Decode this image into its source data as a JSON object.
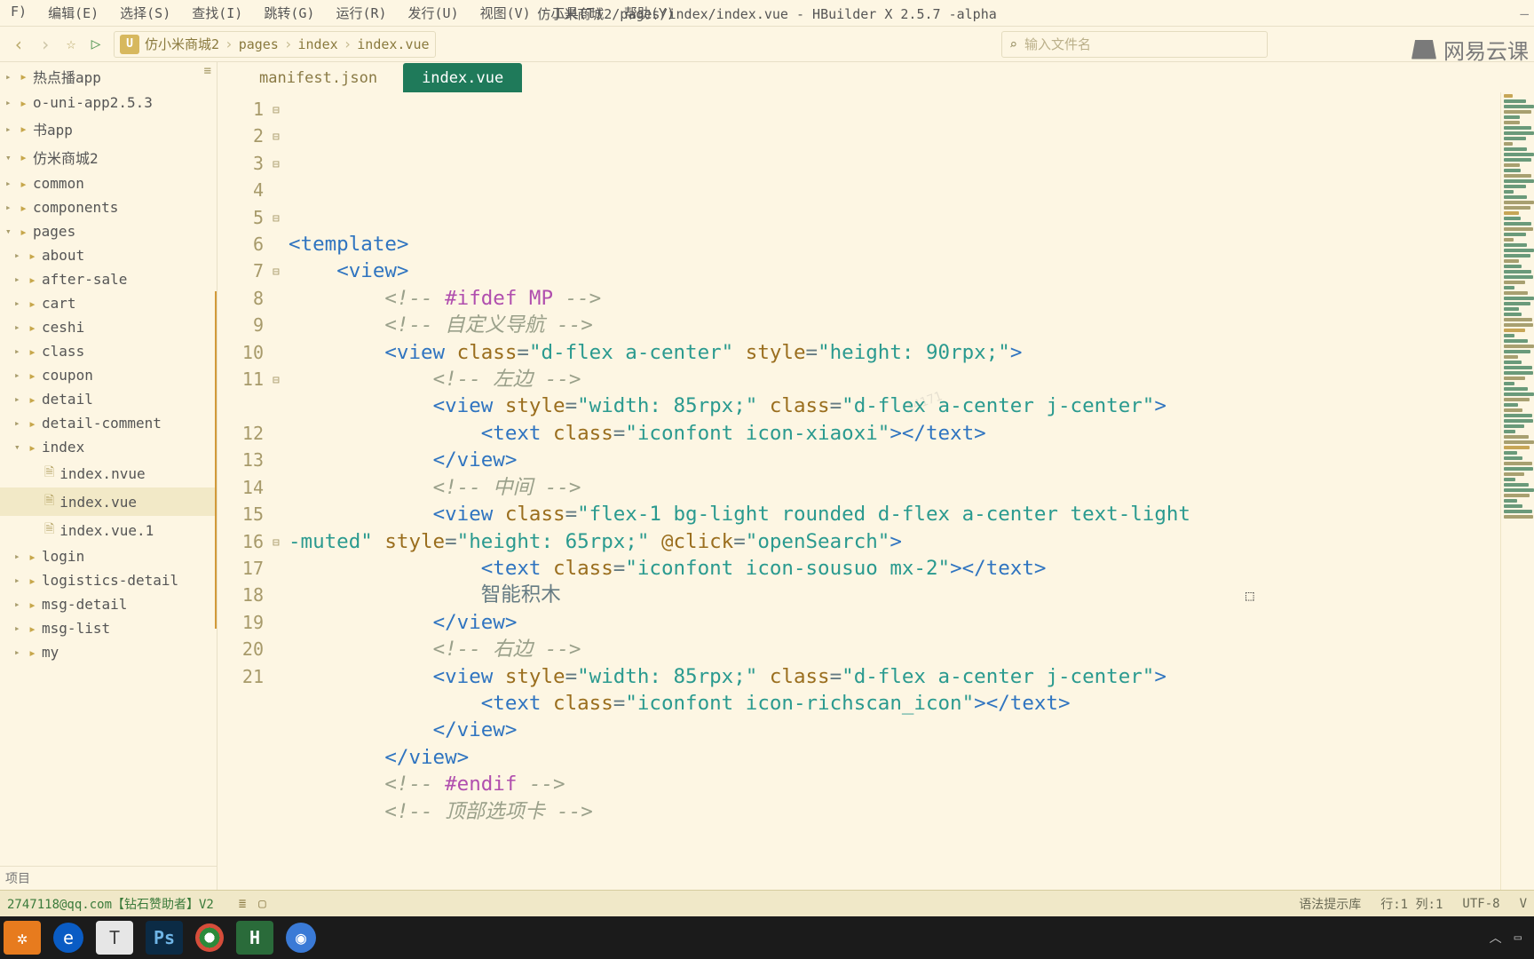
{
  "menu": [
    "F)",
    "编辑(E)",
    "选择(S)",
    "查找(I)",
    "跳转(G)",
    "运行(R)",
    "发行(U)",
    "视图(V)",
    "工具(T)",
    "帮助(Y)"
  ],
  "app_title": "仿小米商城2/pages/index/index.vue - HBuilder X 2.5.7 -alpha",
  "breadcrumb": [
    "仿小米商城2",
    "pages",
    "index",
    "index.vue"
  ],
  "search_placeholder": "输入文件名",
  "brand_text": "网易云课",
  "sidebar": {
    "roots": [
      {
        "label": "热点播app",
        "type": "folder"
      },
      {
        "label": "o-uni-app2.5.3",
        "type": "folder"
      },
      {
        "label": "书app",
        "type": "folder"
      },
      {
        "label": "仿米商城2",
        "type": "folder",
        "expanded": true
      }
    ],
    "children": [
      {
        "label": "common"
      },
      {
        "label": "components"
      },
      {
        "label": "pages",
        "expanded": true,
        "subs": [
          {
            "label": "about"
          },
          {
            "label": "after-sale"
          },
          {
            "label": "cart"
          },
          {
            "label": "ceshi"
          },
          {
            "label": "class"
          },
          {
            "label": "coupon"
          },
          {
            "label": "detail"
          },
          {
            "label": "detail-comment"
          },
          {
            "label": "index",
            "expanded": true,
            "files": [
              {
                "label": "index.nvue"
              },
              {
                "label": "index.vue",
                "active": true
              },
              {
                "label": "index.vue.1"
              }
            ]
          },
          {
            "label": "login"
          },
          {
            "label": "logistics-detail"
          },
          {
            "label": "msg-detail"
          },
          {
            "label": "msg-list"
          },
          {
            "label": "my"
          }
        ]
      }
    ],
    "bottom": "项目"
  },
  "tabs": [
    {
      "label": "manifest.json",
      "active": false
    },
    {
      "label": "index.vue",
      "active": true
    }
  ],
  "code_lines": [
    {
      "n": 1,
      "fold": "⊟",
      "html": "<span class='c-tag'>&lt;template&gt;</span>",
      "hl": true
    },
    {
      "n": 2,
      "fold": "⊟",
      "html": "    <span class='c-tag'>&lt;view&gt;</span>"
    },
    {
      "n": 3,
      "fold": "⊟",
      "html": "        <span class='c-cmt'>&lt;!--</span> <span class='c-kw'>#ifdef MP</span> <span class='c-cmt'>--&gt;</span>"
    },
    {
      "n": 4,
      "fold": "",
      "html": "        <span class='c-cmt'>&lt;!-- 自定义导航 --&gt;</span>"
    },
    {
      "n": 5,
      "fold": "⊟",
      "html": "        <span class='c-tag'>&lt;view</span> <span class='c-attr'>class</span>=<span class='c-str'>\"d-flex a-center\"</span> <span class='c-attr'>style</span>=<span class='c-str'>\"height: 90rpx;\"</span><span class='c-tag'>&gt;</span>"
    },
    {
      "n": 6,
      "fold": "",
      "html": "            <span class='c-cmt'>&lt;!-- 左边 --&gt;</span>"
    },
    {
      "n": 7,
      "fold": "⊟",
      "html": "            <span class='c-tag'>&lt;view</span> <span class='c-attr'>style</span>=<span class='c-str'>\"width: 85rpx;\"</span> <span class='c-attr'>class</span>=<span class='c-str'>\"d-flex a-center j-center\"</span><span class='c-tag'>&gt;</span>"
    },
    {
      "n": 8,
      "fold": "",
      "html": "                <span class='c-tag'>&lt;text</span> <span class='c-attr'>class</span>=<span class='c-str'>\"iconfont icon-xiaoxi\"</span><span class='c-tag'>&gt;&lt;/text&gt;</span>"
    },
    {
      "n": 9,
      "fold": "",
      "html": "            <span class='c-tag'>&lt;/view&gt;</span>"
    },
    {
      "n": 10,
      "fold": "",
      "html": "            <span class='c-cmt'>&lt;!-- 中间 --&gt;</span>"
    },
    {
      "n": 11,
      "fold": "⊟",
      "html": "            <span class='c-tag'>&lt;view</span> <span class='c-attr'>class</span>=<span class='c-str'>\"flex-1 bg-light rounded d-flex a-center text-light</span>"
    },
    {
      "n": "",
      "fold": "",
      "html": "<span class='c-str'>-muted\"</span> <span class='c-attr'>style</span>=<span class='c-str'>\"height: 65rpx;\"</span> <span class='c-click'>@click</span>=<span class='c-str'>\"openSearch\"</span><span class='c-tag'>&gt;</span>"
    },
    {
      "n": 12,
      "fold": "",
      "html": "                <span class='c-tag'>&lt;text</span> <span class='c-attr'>class</span>=<span class='c-str'>\"iconfont icon-sousuo mx-2\"</span><span class='c-tag'>&gt;&lt;/text&gt;</span>"
    },
    {
      "n": 13,
      "fold": "",
      "html": "                <span class='c-plain'>智能积木</span>"
    },
    {
      "n": 14,
      "fold": "",
      "html": "            <span class='c-tag'>&lt;/view&gt;</span>"
    },
    {
      "n": 15,
      "fold": "",
      "html": "            <span class='c-cmt'>&lt;!-- 右边 --&gt;</span>"
    },
    {
      "n": 16,
      "fold": "⊟",
      "html": "            <span class='c-tag'>&lt;view</span> <span class='c-attr'>style</span>=<span class='c-str'>\"width: 85rpx;\"</span> <span class='c-attr'>class</span>=<span class='c-str'>\"d-flex a-center j-center\"</span><span class='c-tag'>&gt;</span>"
    },
    {
      "n": 17,
      "fold": "",
      "html": "                <span class='c-tag'>&lt;text</span> <span class='c-attr'>class</span>=<span class='c-str'>\"iconfont icon-richscan_icon\"</span><span class='c-tag'>&gt;&lt;/text&gt;</span>"
    },
    {
      "n": 18,
      "fold": "",
      "html": "            <span class='c-tag'>&lt;/view&gt;</span>"
    },
    {
      "n": 19,
      "fold": "",
      "html": "        <span class='c-tag'>&lt;/view&gt;</span>"
    },
    {
      "n": 20,
      "fold": "",
      "html": "        <span class='c-cmt'>&lt;!--</span> <span class='c-kw'>#endif</span> <span class='c-cmt'>--&gt;</span>"
    },
    {
      "n": 21,
      "fold": "",
      "html": "        <span class='c-cmt'>&lt;!-- 顶部选项卡 --&gt;</span>"
    }
  ],
  "status": {
    "left": "2747118@qq.com【钻石赞助者】V2",
    "syntax": "语法提示库",
    "pos": "行:1  列:1",
    "enc": "UTF-8",
    "lang": "V"
  },
  "watermark": "14171"
}
